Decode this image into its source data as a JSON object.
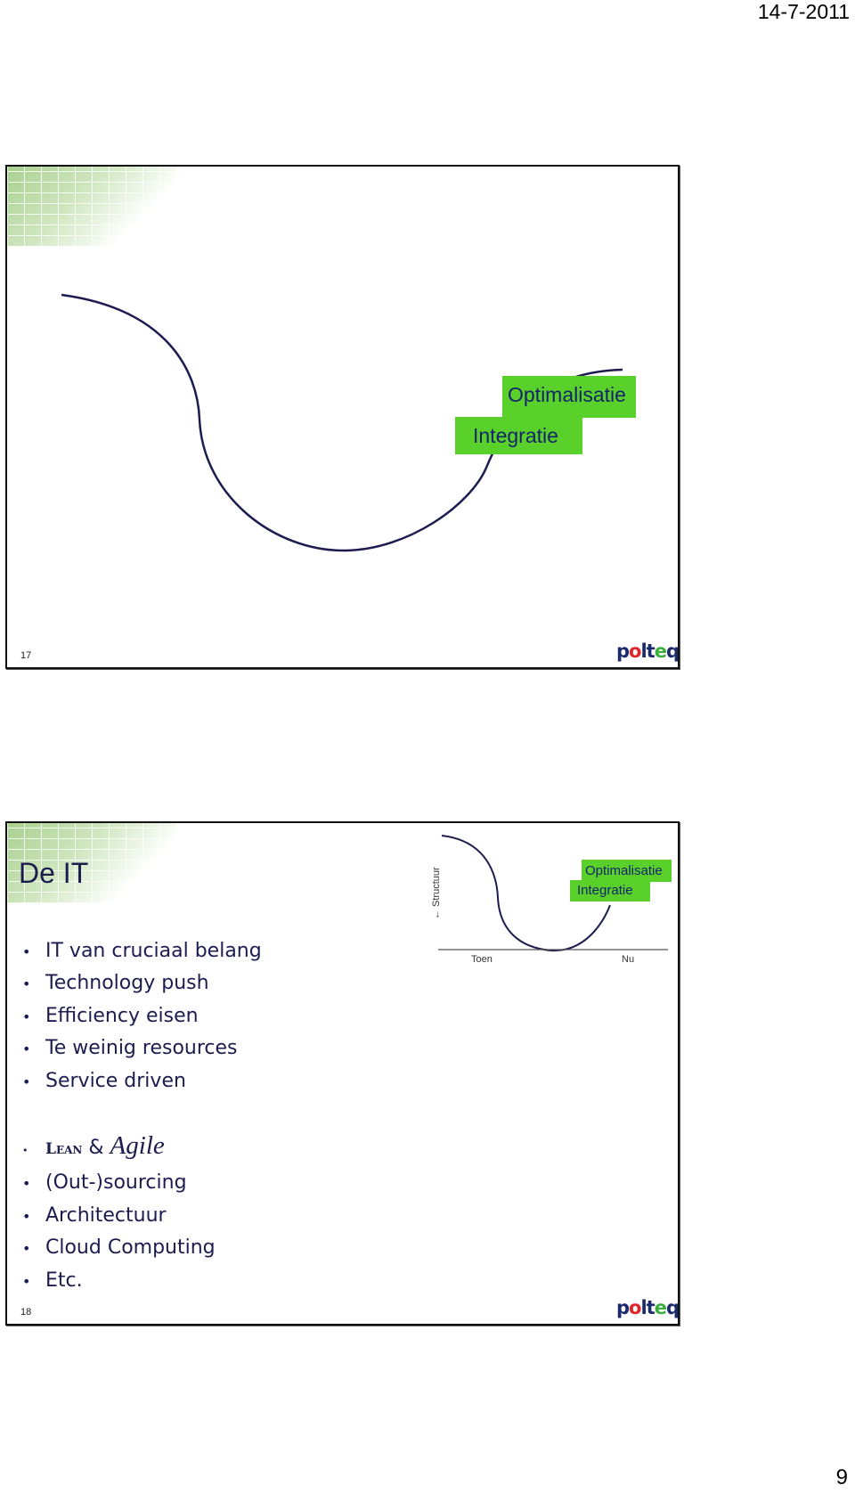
{
  "header": {
    "date": "14-7-2011"
  },
  "footer": {
    "page_number": "9"
  },
  "slide17": {
    "number": "17",
    "labels": {
      "optimalisatie": "Optimalisatie",
      "integratie": "Integratie"
    },
    "logo": "polteq",
    "accent_color": "#5ad12a",
    "curve_color": "#1c1c50"
  },
  "slide18": {
    "number": "18",
    "title": "De IT",
    "logo": "polteq",
    "bullets_1": [
      "IT van cruciaal belang",
      "Technology push",
      "Efficiency eisen",
      "Te weinig resources",
      "Service driven"
    ],
    "lean": "Lean",
    "amp": "&",
    "agile": "Agile",
    "bullets_2": [
      "(Out-)sourcing",
      "Architectuur",
      "Cloud Computing",
      "Etc."
    ],
    "chart": {
      "y_label": "Structuur",
      "y_arrow": "←",
      "x_start": "Toen",
      "x_end": "Nu",
      "optimalisatie": "Optimalisatie",
      "integratie": "Integratie"
    }
  }
}
